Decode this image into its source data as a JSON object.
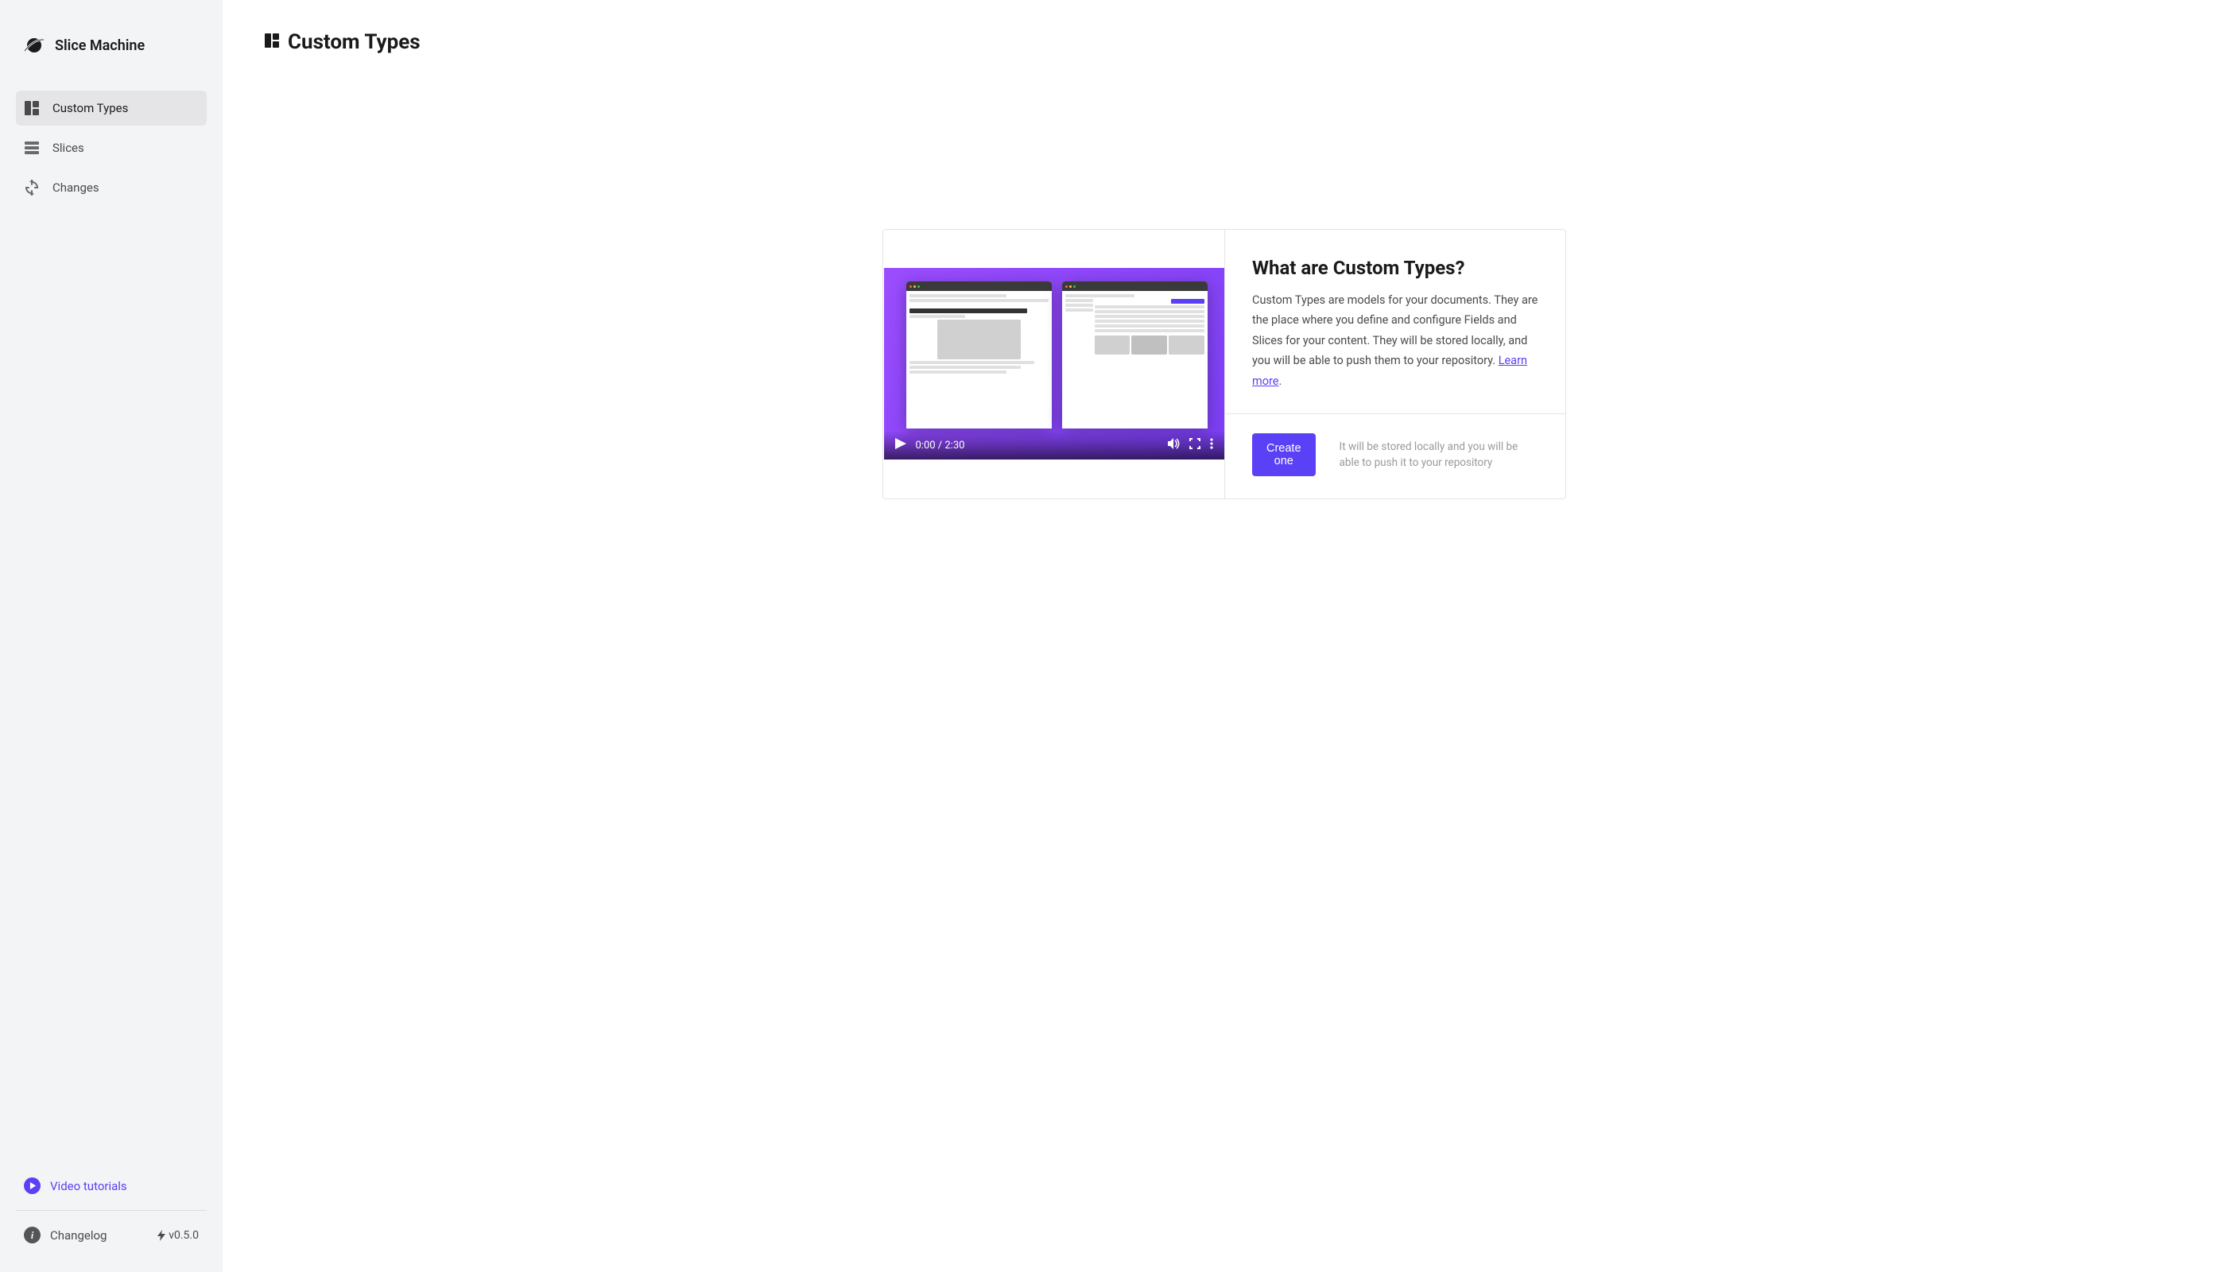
{
  "app": {
    "name": "Slice Machine"
  },
  "sidebar": {
    "items": [
      {
        "label": "Custom Types",
        "active": true
      },
      {
        "label": "Slices",
        "active": false
      },
      {
        "label": "Changes",
        "active": false
      }
    ],
    "tutorials_label": "Video tutorials",
    "changelog_label": "Changelog",
    "version": "v0.5.0"
  },
  "page": {
    "title": "Custom Types"
  },
  "video": {
    "time": "0:00 / 2:30"
  },
  "info": {
    "heading": "What are Custom Types?",
    "description": "Custom Types are models for your documents. They are the place where you define and configure Fields and Slices for your content. They will be stored locally, and you will be able to push them to your repository. ",
    "learn_more": "Learn more",
    "period": "."
  },
  "action": {
    "button_label": "Create one",
    "hint": "It will be stored locally and you will be able to push it to your repository"
  }
}
